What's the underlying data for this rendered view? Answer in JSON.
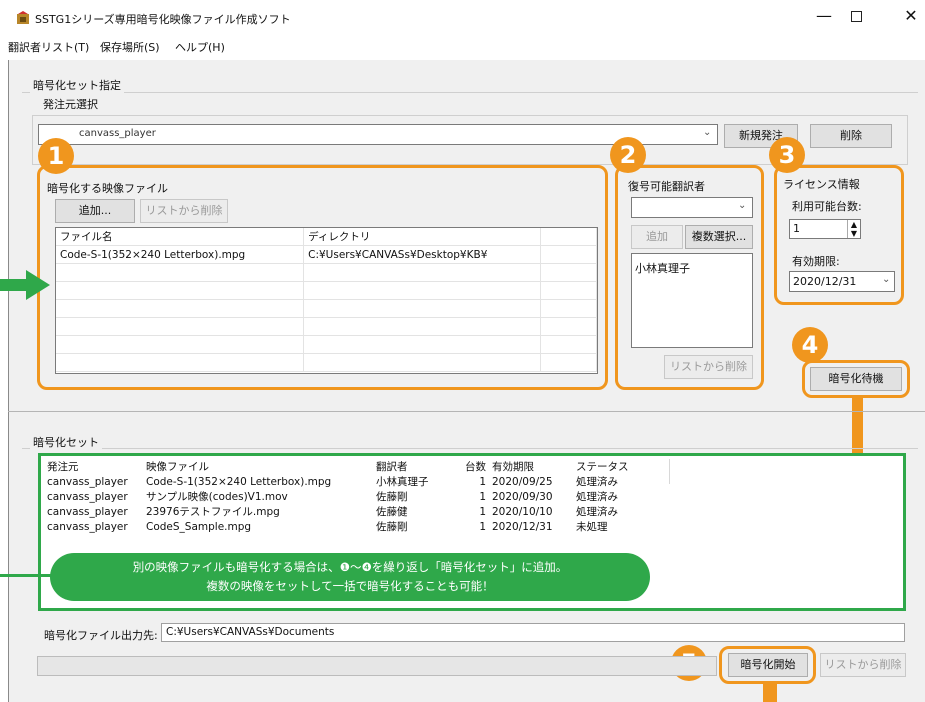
{
  "window": {
    "title": "SSTG1シリーズ専用暗号化映像ファイル作成ソフト"
  },
  "menu": [
    "翻訳者リスト(T)",
    "保存場所(S)",
    "ヘルプ(H)"
  ],
  "set_spec": {
    "group_label": "暗号化セット指定",
    "source_label": "発注元選択",
    "source_value": "canvass_player",
    "new_button": "新規発注",
    "delete_button": "削除"
  },
  "video_panel": {
    "label": "暗号化する映像ファイル",
    "add_button": "追加...",
    "remove_button": "リストから削除",
    "columns": [
      "ファイル名",
      "ディレクトリ"
    ],
    "rows": [
      [
        "Code-S-1(352×240  Letterbox).mpg",
        "C:¥Users¥CANVASs¥Desktop¥KB¥"
      ]
    ]
  },
  "translator_panel": {
    "label": "復号可能翻訳者",
    "add_button": "追加",
    "multi_select_button": "複数選択...",
    "list": [
      "小林真理子"
    ],
    "remove_button": "リストから削除"
  },
  "license_panel": {
    "label": "ライセンス情報",
    "available_label": "利用可能台数:",
    "available_value": "1",
    "expiry_label": "有効期限:",
    "expiry_value": "2020/12/31"
  },
  "queue_button": "暗号化待機",
  "encrypt_set": {
    "label": "暗号化セット",
    "columns": [
      "発注元",
      "映像ファイル",
      "翻訳者",
      "台数",
      "有効期限",
      "ステータス"
    ],
    "rows": [
      [
        "canvass_player",
        "Code-S-1(352×240  Letterbox).mpg",
        "小林真理子",
        "1",
        "2020/09/25",
        "処理済み"
      ],
      [
        "canvass_player",
        "サンプル映像(codes)V1.mov",
        "佐藤剛",
        "1",
        "2020/09/30",
        "処理済み"
      ],
      [
        "canvass_player",
        "23976テストファイル.mpg",
        "佐藤健",
        "1",
        "2020/10/10",
        "処理済み"
      ],
      [
        "canvass_player",
        "CodeS_Sample.mpg",
        "佐藤剛",
        "1",
        "2020/12/31",
        "未処理"
      ]
    ]
  },
  "callout": {
    "line1": "別の映像ファイルも暗号化する場合は、❶～❹を繰り返し「暗号化セット」に追加。",
    "line2": "複数の映像をセットして一括で暗号化することも可能！"
  },
  "output": {
    "label": "暗号化ファイル出力先:",
    "value": "C:¥Users¥CANVASs¥Documents"
  },
  "start_button": "暗号化開始",
  "remove_list_button": "リストから削除",
  "steps": [
    "1",
    "2",
    "3",
    "4",
    "5"
  ],
  "colors": {
    "orange": "#f0961e",
    "green": "#2fa84a",
    "window_bg": "#f0f0f0"
  }
}
